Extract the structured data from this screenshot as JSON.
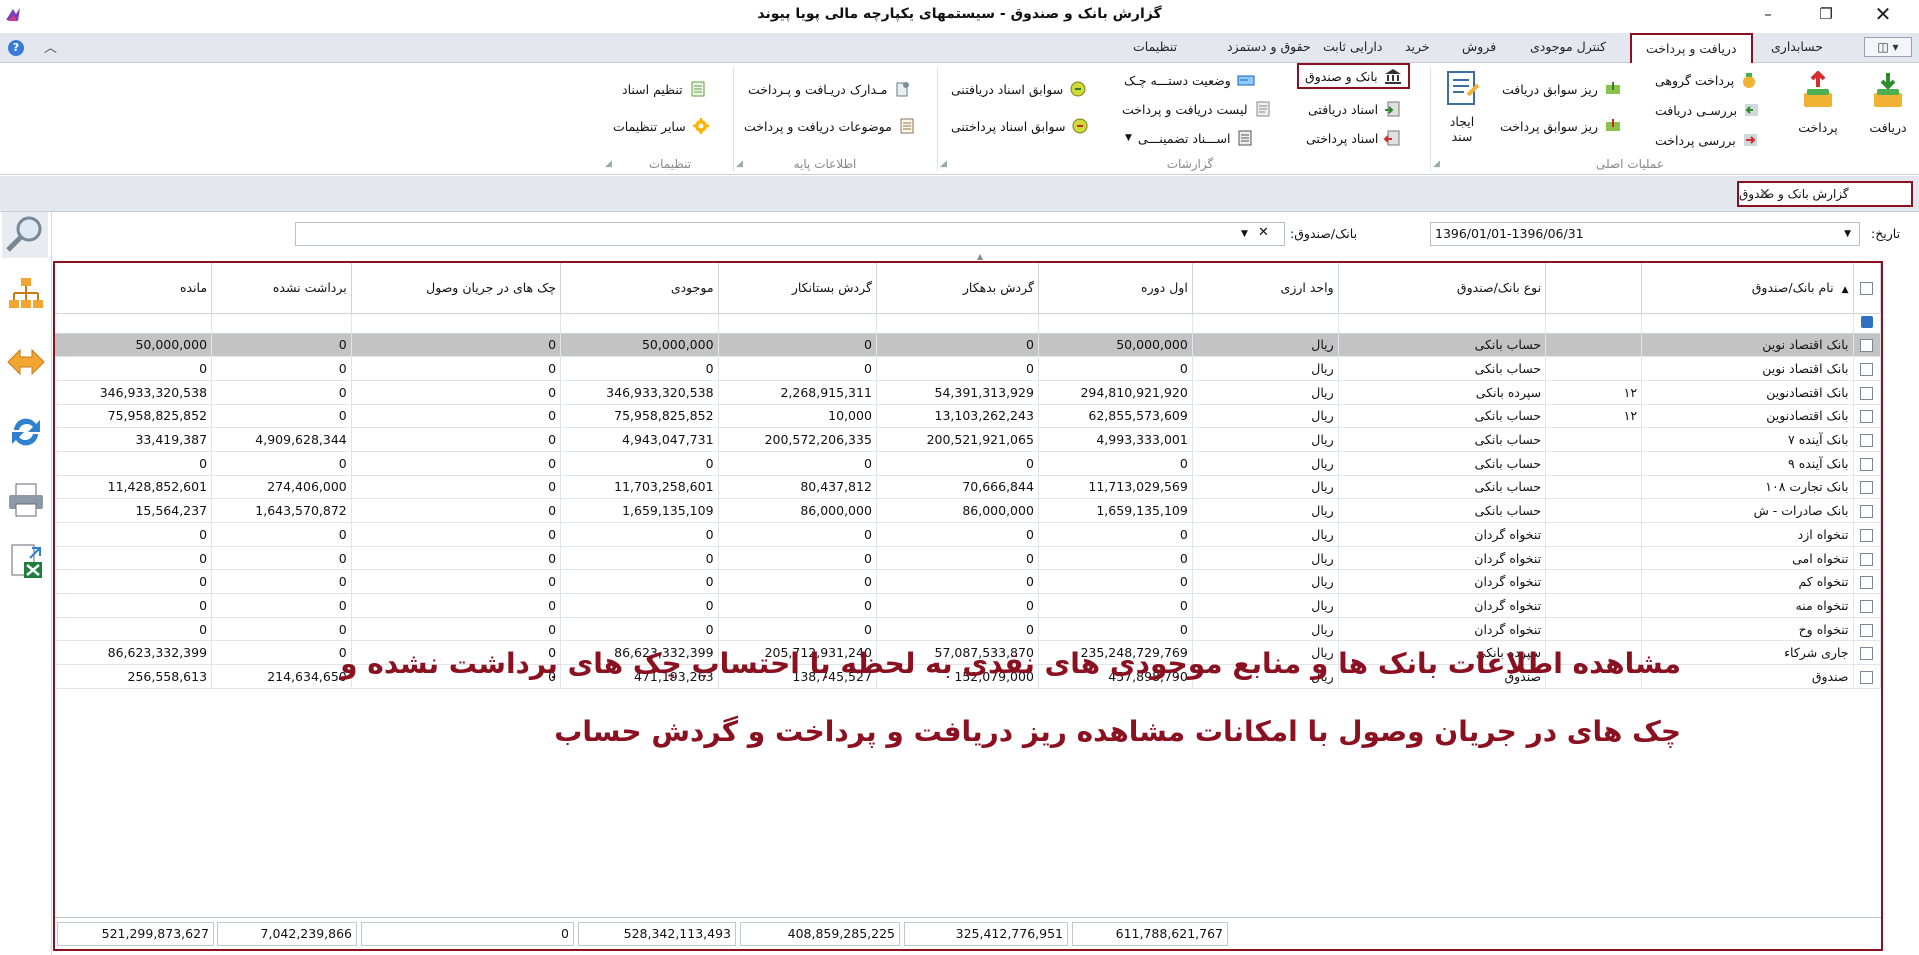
{
  "window": {
    "title": "گزارش بانک و صندوق - سیستمهای یکپارچه مالی پویا پیوند",
    "minimize": "–",
    "maximize": "❐",
    "close": "✕"
  },
  "ribbon_tabs": [
    {
      "label": "حسابداری"
    },
    {
      "label": "دریافت و پرداخت",
      "active": true
    },
    {
      "label": "کنترل موجودی"
    },
    {
      "label": "فروش"
    },
    {
      "label": "خرید"
    },
    {
      "label": "دارایی ثابت"
    },
    {
      "label": "حقوق و دستمزد"
    },
    {
      "label": "تنظیمات"
    }
  ],
  "ribbon": {
    "groups": {
      "main_ops": "عملیات اصلی",
      "reports": "گزارشات",
      "base_info": "اطلاعات پایه",
      "settings": "تنظیمات"
    },
    "big_buttons": {
      "receive": "دریافت",
      "pay": "پرداخت",
      "create_doc_1": "ایجاد",
      "create_doc_2": "سند"
    },
    "main_ops": {
      "group_pay": "پرداخت گروهی",
      "review_receive": "بررسـی دریافت",
      "review_pay": "بررسی پرداخت",
      "receive_details": "ریز سوابق دریافت",
      "pay_details": "ریز سوابق پرداخت"
    },
    "reports": {
      "bank_and_cash": "بانک و صندوق",
      "received_docs": "اسناد دریافتی",
      "paid_docs": "اسناد پرداختی",
      "checkbook_status": "وضعیت دستـــه چـک",
      "receive_pay_list": "لیست دریافت و پرداخت",
      "guarantee_docs": "اســـناد تضمینـــی",
      "received_docs_history": "سوابق اسناد دریافتنی",
      "paid_docs_history": "سوابق اسناد پرداختنی"
    },
    "base_info": {
      "receive_pay_documents": "مـدارک دریـافت و پـرداخت",
      "receive_pay_subjects": "موضوعات دریافت و پرداخت"
    },
    "settings": {
      "doc_setup": "تنظیم اسناد",
      "other_settings": "سایر تنظیمات"
    }
  },
  "document_tab": {
    "label": "گزارش بانک و صندوق",
    "close": "✕"
  },
  "filters": {
    "date_label": "تاریخ:",
    "date_value": "1396/01/01-1396/06/31",
    "bank_label": "بانک/صندوق:",
    "bank_value": "",
    "clear": "✕",
    "dropdown": "▼"
  },
  "grid": {
    "columns": [
      {
        "key": "name",
        "label": "نام بانک/صندوق",
        "sort": "▲"
      },
      {
        "key": "code",
        "label": ""
      },
      {
        "key": "type",
        "label": "نوع بانک/صندوق"
      },
      {
        "key": "currency",
        "label": "واحد ارزی"
      },
      {
        "key": "opening",
        "label": "اول دوره"
      },
      {
        "key": "debit",
        "label": "گردش بدهکار"
      },
      {
        "key": "credit",
        "label": "گردش بستانکار"
      },
      {
        "key": "balance",
        "label": "موجودی"
      },
      {
        "key": "in_collection",
        "label": "چک های در جریان وصول"
      },
      {
        "key": "not_cashed",
        "label": "برداشت نشده"
      },
      {
        "key": "remaining",
        "label": "مانده"
      }
    ],
    "rows": [
      {
        "name": "بانک اقتصاد نوین",
        "code": "",
        "type": "حساب بانکی",
        "currency": "ریال",
        "opening": "50,000,000",
        "debit": "0",
        "credit": "0",
        "balance": "50,000,000",
        "in_collection": "0",
        "not_cashed": "0",
        "remaining": "50,000,000",
        "selected": true
      },
      {
        "name": "بانک اقتصاد نوین",
        "code": "",
        "type": "حساب بانکی",
        "currency": "ریال",
        "opening": "0",
        "debit": "0",
        "credit": "0",
        "balance": "0",
        "in_collection": "0",
        "not_cashed": "0",
        "remaining": "0"
      },
      {
        "name": "بانک اقتصادنوین",
        "code": "۱۲",
        "type": "سپرده بانکی",
        "currency": "ریال",
        "opening": "294,810,921,920",
        "debit": "54,391,313,929",
        "credit": "2,268,915,311",
        "balance": "346,933,320,538",
        "in_collection": "0",
        "not_cashed": "0",
        "remaining": "346,933,320,538"
      },
      {
        "name": "بانک اقتصادنوین",
        "code": "۱۲",
        "type": "حساب بانکی",
        "currency": "ریال",
        "opening": "62,855,573,609",
        "debit": "13,103,262,243",
        "credit": "10,000",
        "balance": "75,958,825,852",
        "in_collection": "0",
        "not_cashed": "0",
        "remaining": "75,958,825,852"
      },
      {
        "name": "بانک آینده ۷",
        "code": "",
        "type": "حساب بانکی",
        "currency": "ریال",
        "opening": "4,993,333,001",
        "debit": "200,521,921,065",
        "credit": "200,572,206,335",
        "balance": "4,943,047,731",
        "in_collection": "0",
        "not_cashed": "4,909,628,344",
        "remaining": "33,419,387"
      },
      {
        "name": "بانک آینده ۹",
        "code": "",
        "type": "حساب بانکی",
        "currency": "ریال",
        "opening": "0",
        "debit": "0",
        "credit": "0",
        "balance": "0",
        "in_collection": "0",
        "not_cashed": "0",
        "remaining": "0"
      },
      {
        "name": "بانک تجارت ۱۰۸",
        "code": "",
        "type": "حساب بانکی",
        "currency": "ریال",
        "opening": "11,713,029,569",
        "debit": "70,666,844",
        "credit": "80,437,812",
        "balance": "11,703,258,601",
        "in_collection": "0",
        "not_cashed": "274,406,000",
        "remaining": "11,428,852,601"
      },
      {
        "name": "بانک صادرات - ش",
        "code": "",
        "type": "حساب بانکی",
        "currency": "ریال",
        "opening": "1,659,135,109",
        "debit": "86,000,000",
        "credit": "86,000,000",
        "balance": "1,659,135,109",
        "in_collection": "0",
        "not_cashed": "1,643,570,872",
        "remaining": "15,564,237"
      },
      {
        "name": "تنخواه ازد",
        "code": "",
        "type": "تنخواه گردان",
        "currency": "ریال",
        "opening": "0",
        "debit": "0",
        "credit": "0",
        "balance": "0",
        "in_collection": "0",
        "not_cashed": "0",
        "remaining": "0"
      },
      {
        "name": "تنخواه امی",
        "code": "",
        "type": "تنخواه گردان",
        "currency": "ریال",
        "opening": "0",
        "debit": "0",
        "credit": "0",
        "balance": "0",
        "in_collection": "0",
        "not_cashed": "0",
        "remaining": "0"
      },
      {
        "name": "تنخواه کم",
        "code": "",
        "type": "تنخواه گردان",
        "currency": "ریال",
        "opening": "0",
        "debit": "0",
        "credit": "0",
        "balance": "0",
        "in_collection": "0",
        "not_cashed": "0",
        "remaining": "0"
      },
      {
        "name": "تنخواه منه",
        "code": "",
        "type": "تنخواه گردان",
        "currency": "ریال",
        "opening": "0",
        "debit": "0",
        "credit": "0",
        "balance": "0",
        "in_collection": "0",
        "not_cashed": "0",
        "remaining": "0"
      },
      {
        "name": "تنخواه وح",
        "code": "",
        "type": "تنخواه گردان",
        "currency": "ریال",
        "opening": "0",
        "debit": "0",
        "credit": "0",
        "balance": "0",
        "in_collection": "0",
        "not_cashed": "0",
        "remaining": "0"
      },
      {
        "name": "جاری شرکاء",
        "code": "",
        "type": "سپرده بانکی",
        "currency": "ریال",
        "opening": "235,248,729,769",
        "debit": "57,087,533,870",
        "credit": "205,712,931,240",
        "balance": "86,623,332,399",
        "in_collection": "0",
        "not_cashed": "0",
        "remaining": "86,623,332,399"
      },
      {
        "name": "صندوق",
        "code": "",
        "type": "صندوق",
        "currency": "ریال",
        "opening": "457,898,790",
        "debit": "152,079,000",
        "credit": "138,745,527",
        "balance": "471,193,263",
        "in_collection": "0",
        "not_cashed": "214,634,650",
        "remaining": "256,558,613"
      }
    ],
    "totals": {
      "opening": "611,788,621,767",
      "debit": "325,412,776,951",
      "credit": "408,859,285,225",
      "balance": "528,342,113,493",
      "in_collection": "0",
      "not_cashed": "7,042,239,866",
      "remaining": "521,299,873,627"
    }
  },
  "overlay": {
    "line1": "مشاهده اطلاعات بانک ها و منابع موجودی های نقدی به لحظه با احتساب چک های برداشت نشده و",
    "line2": "چک های در جریان وصول با امکانات مشاهده ریز دریافت و پرداخت و گردش حساب"
  },
  "colors": {
    "accent_frame": "#8b1020",
    "ribbon_bg": "#e4e8ee",
    "selected_row": "#c3c3c3"
  }
}
